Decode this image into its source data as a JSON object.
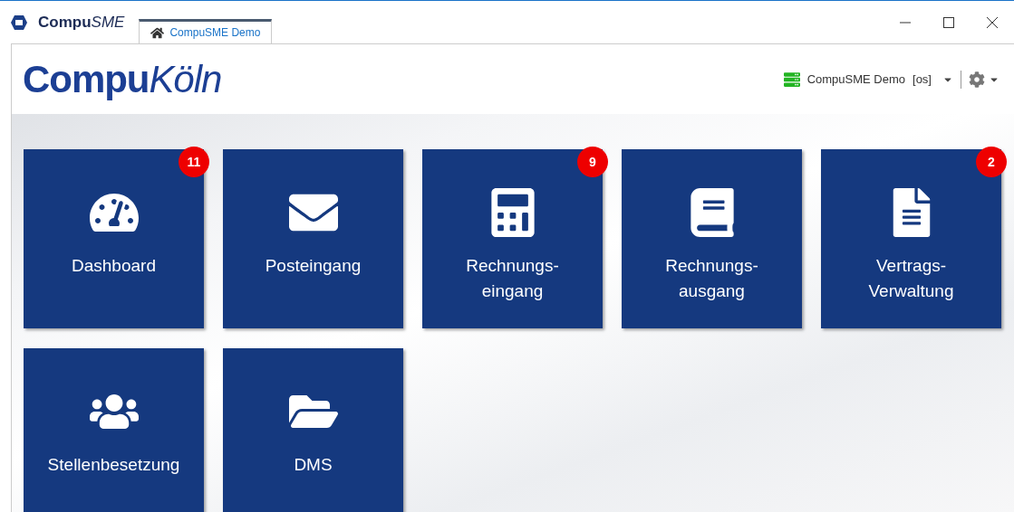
{
  "window": {
    "title_bold": "Compu",
    "title_italic": "SME"
  },
  "tabs": [
    {
      "label": "CompuSME Demo",
      "selected": true
    }
  ],
  "header": {
    "logo_bold": "Compu",
    "logo_italic": "Köln",
    "database": "CompuSME Demo",
    "database_suffix": "[os]"
  },
  "tiles": [
    {
      "lines": [
        "Dashboard"
      ],
      "badge": "11"
    },
    {
      "lines": [
        "Posteingang"
      ]
    },
    {
      "lines": [
        "Rechnungs-",
        "eingang"
      ],
      "badge": "9"
    },
    {
      "lines": [
        "Rechnungs-",
        "ausgang"
      ]
    },
    {
      "lines": [
        "Vertrags-",
        "Verwaltung"
      ],
      "badge": "2"
    },
    {
      "lines": [
        "Stellenbesetzung"
      ]
    },
    {
      "lines": [
        "DMS"
      ]
    }
  ]
}
